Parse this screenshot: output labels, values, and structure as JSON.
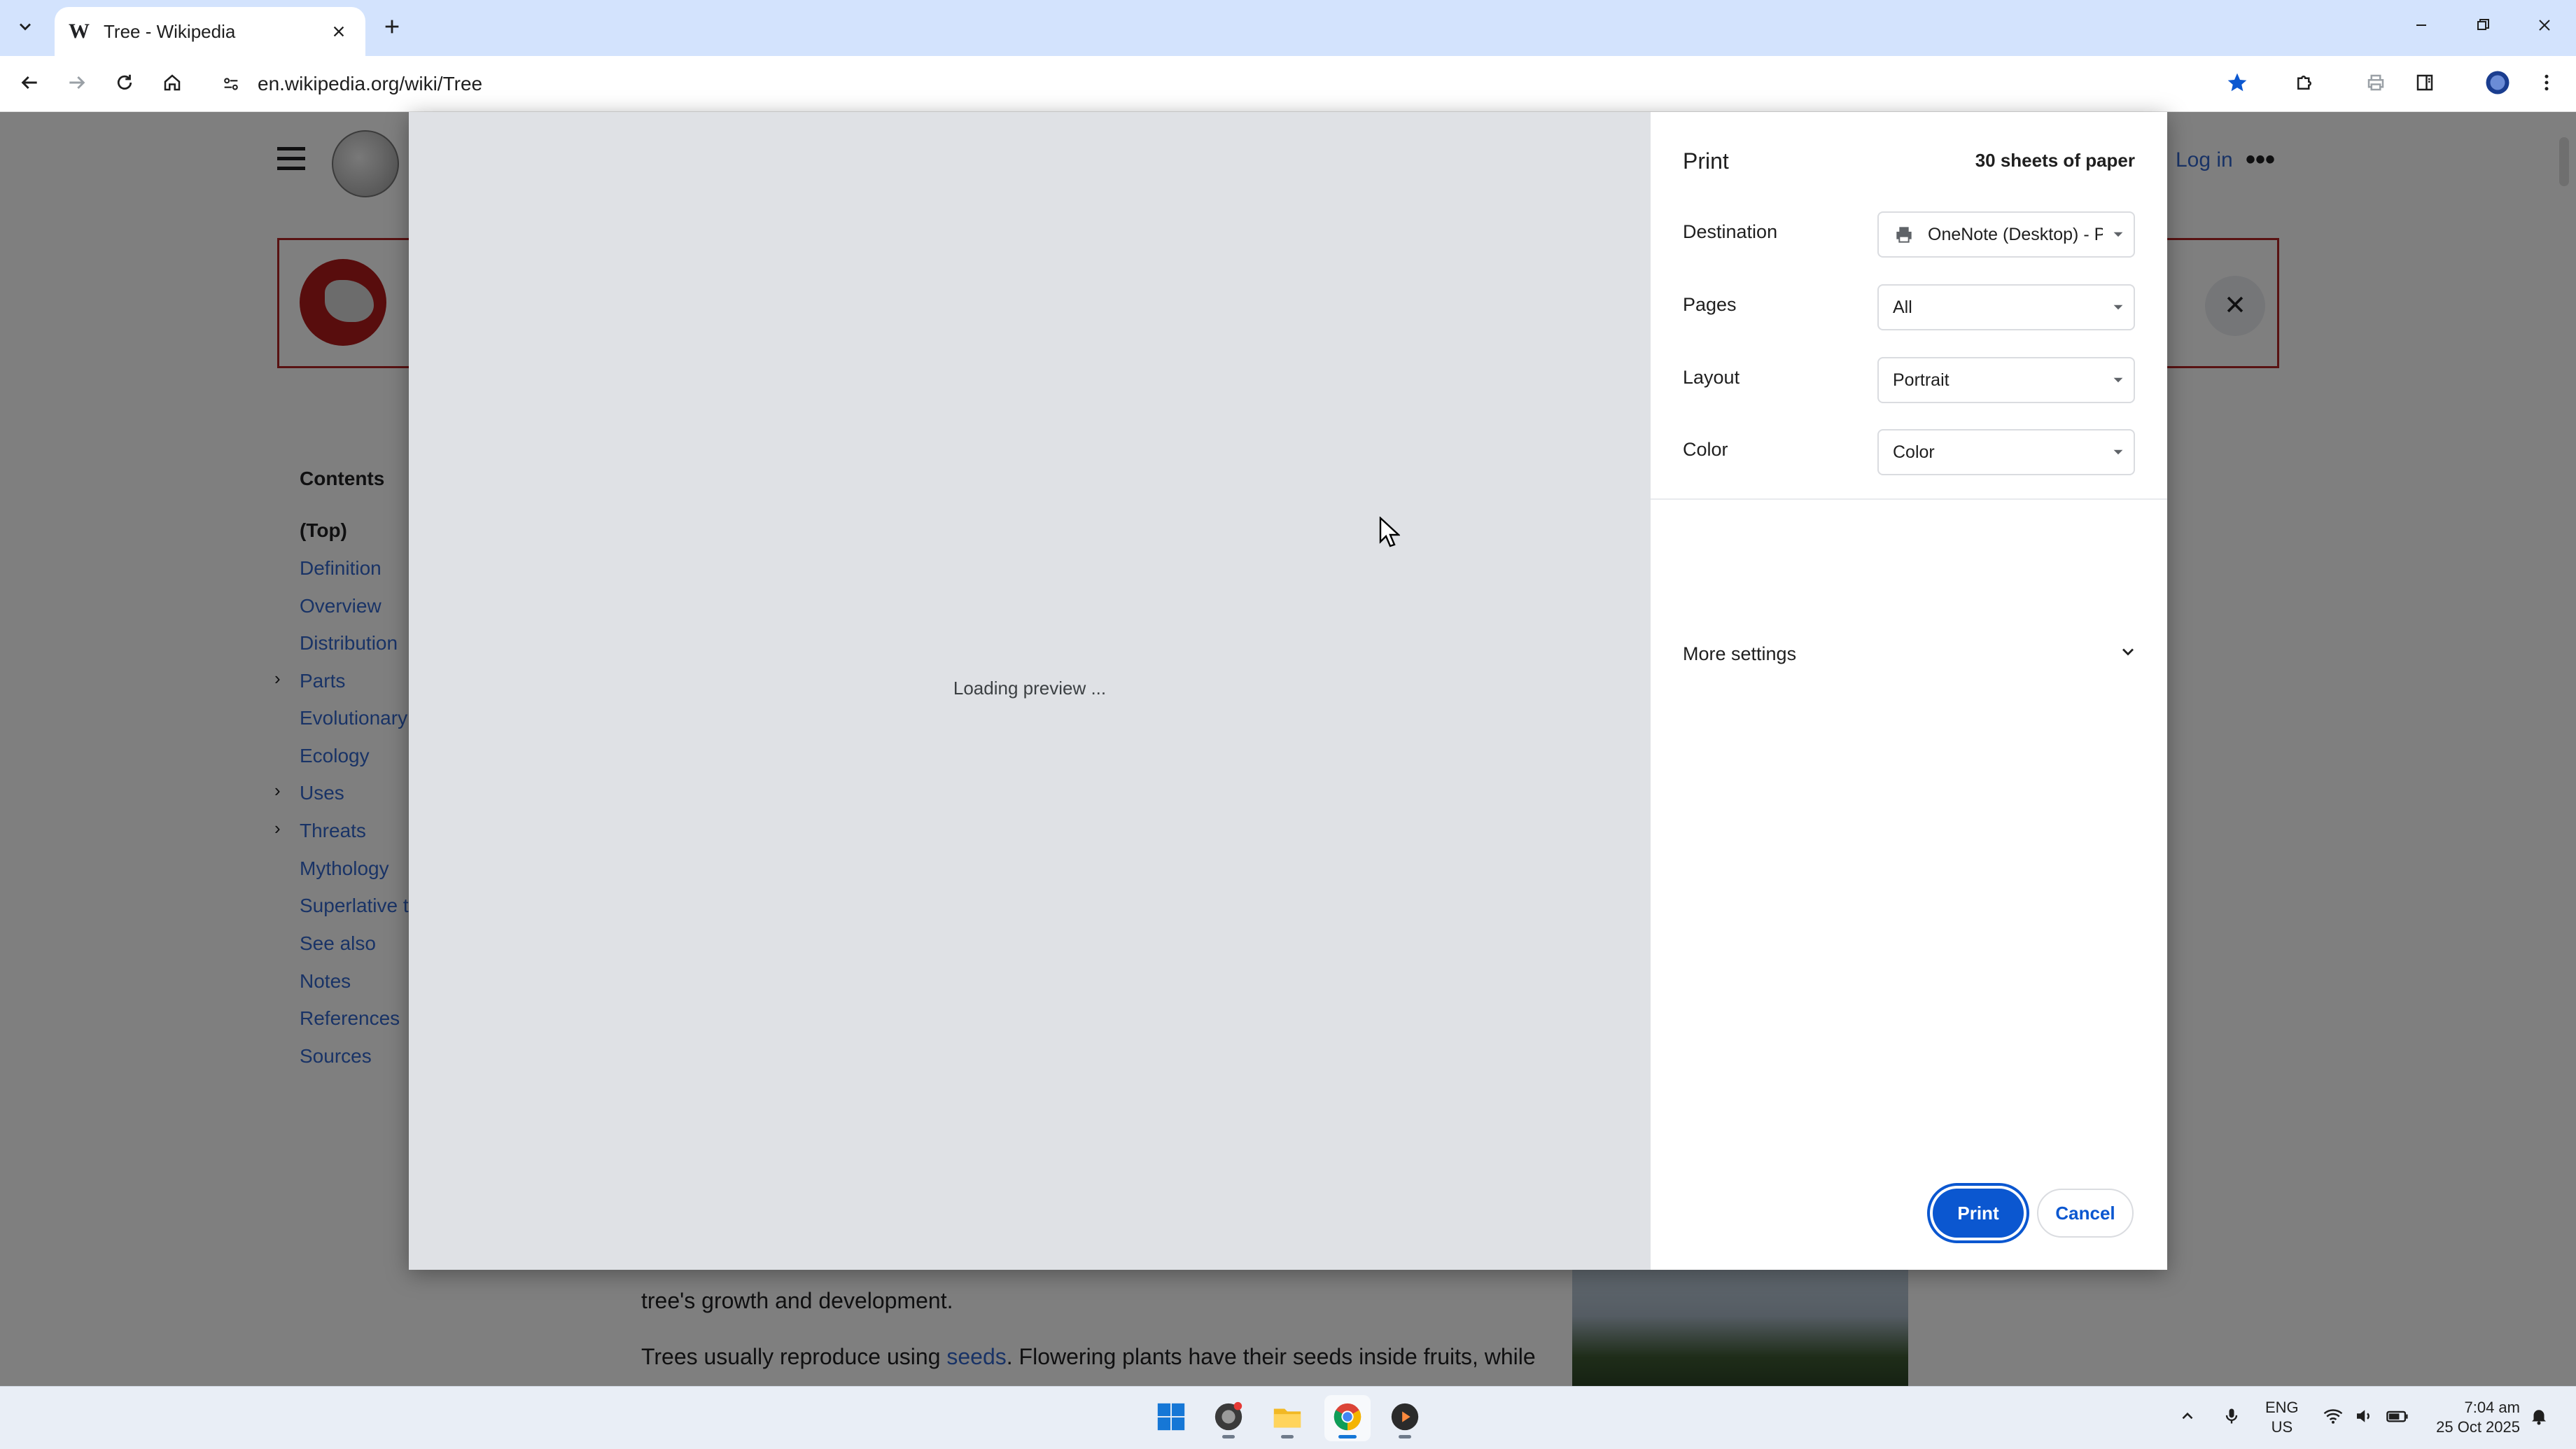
{
  "browser": {
    "tab_title": "Tree - Wikipedia",
    "tab_favicon": "W",
    "url": "en.wikipedia.org/wiki/Tree"
  },
  "wiki": {
    "login": "Log in",
    "more": "•••",
    "toc": {
      "title": "Contents",
      "items": [
        "(Top)",
        "Definition",
        "Overview",
        "Distribution",
        "Parts",
        "Evolutionary",
        "Ecology",
        "Uses",
        "Threats",
        "Mythology",
        "Superlative tr",
        "See also",
        "Notes",
        "References",
        "Sources"
      ]
    },
    "article": {
      "line1": "tree's growth and development.",
      "line2_pre": "Trees usually reproduce using ",
      "line2_link": "seeds",
      "line2_post": ". Flowering plants have their seeds inside fruits, while"
    }
  },
  "print": {
    "title": "Print",
    "sheets": "30 sheets of paper",
    "loading": "Loading preview ...",
    "destination": {
      "label": "Destination",
      "value": "OneNote (Desktop) - Pr"
    },
    "pages": {
      "label": "Pages",
      "value": "All"
    },
    "layout": {
      "label": "Layout",
      "value": "Portrait"
    },
    "color": {
      "label": "Color",
      "value": "Color"
    },
    "more_settings": "More settings",
    "print_button": "Print",
    "cancel_button": "Cancel"
  },
  "taskbar": {
    "lang_top": "ENG",
    "lang_bottom": "US",
    "time": "7:04 am",
    "date": "25 Oct 2025"
  },
  "colors": {
    "accent": "#0b57d0",
    "link": "#3366cc",
    "tabstrip": "#d3e3fd"
  }
}
